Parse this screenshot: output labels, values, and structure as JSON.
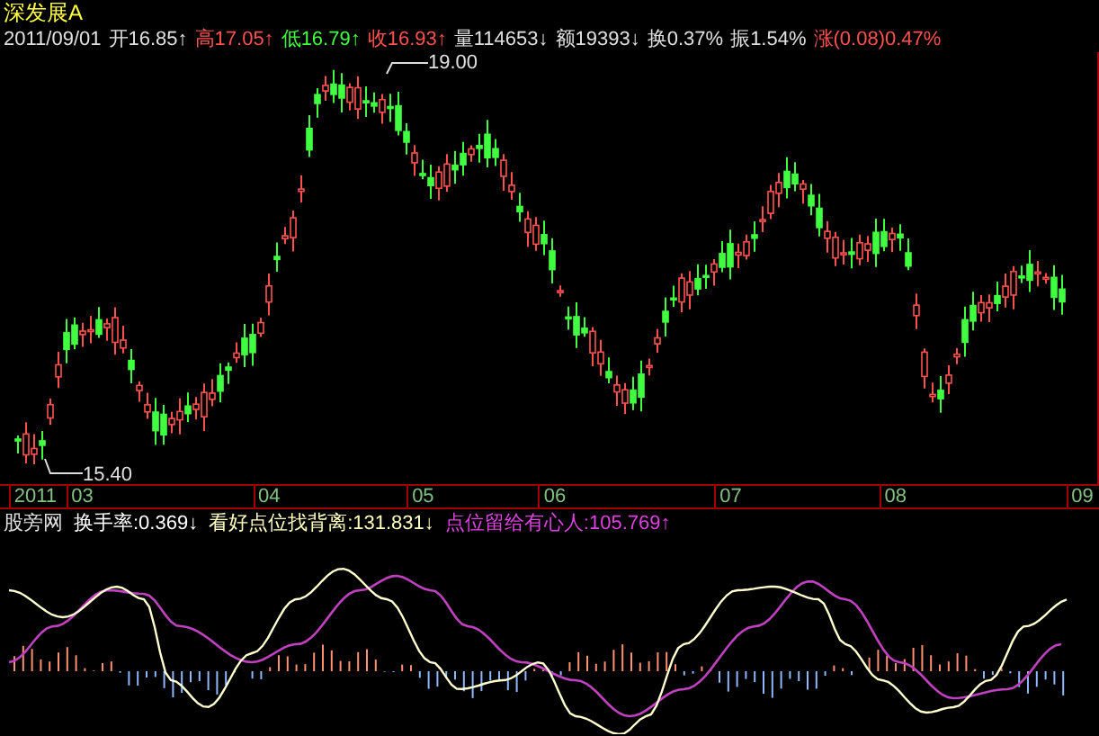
{
  "security": {
    "name": "深发展A"
  },
  "quote": [
    {
      "kind": "date",
      "label": "2011/09/01"
    },
    {
      "kind": "flat",
      "label": "开",
      "value": "16.85",
      "arrow": "↑"
    },
    {
      "kind": "up",
      "label": "高",
      "value": "17.05",
      "arrow": "↑"
    },
    {
      "kind": "down",
      "label": "低",
      "value": "16.79",
      "arrow": "↑"
    },
    {
      "kind": "up",
      "label": "收",
      "value": "16.93",
      "arrow": "↑"
    },
    {
      "kind": "flat",
      "label": "量",
      "value": "114653",
      "arrow": "↓"
    },
    {
      "kind": "flat",
      "label": "额",
      "value": "19393",
      "arrow": "↓"
    },
    {
      "kind": "flat",
      "label": "换",
      "value": "0.37%"
    },
    {
      "kind": "flat",
      "label": "振",
      "value": "1.54%"
    },
    {
      "kind": "up",
      "label": "涨",
      "value": "(0.08)0.47%"
    }
  ],
  "price_chart": {
    "high_marker": "19.00",
    "low_marker": "15.40"
  },
  "months": [
    "2011",
    "03",
    "04",
    "05",
    "06",
    "07",
    "08",
    "09"
  ],
  "indicator": {
    "title": "股旁网",
    "items": [
      {
        "text": "换手率:0.369↓",
        "color": "#ffffff"
      },
      {
        "text": "看好点位找背离:131.831↓",
        "color": "#ffffc0"
      },
      {
        "text": "点位留给有心人:105.769↑",
        "color": "#e040e0"
      }
    ]
  }
}
